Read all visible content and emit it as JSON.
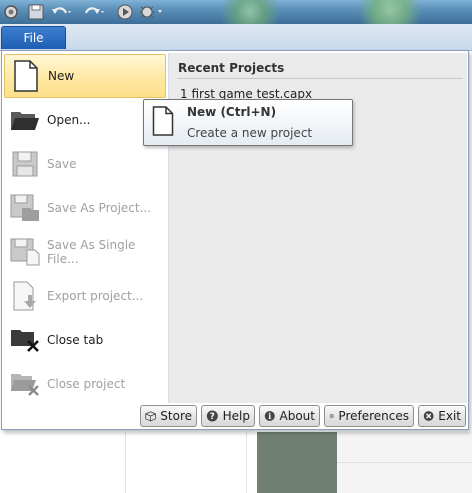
{
  "window": {
    "file_tab_label": "File"
  },
  "menu": {
    "items": [
      {
        "label": "New",
        "enabled": true,
        "icon": "new-document-icon"
      },
      {
        "label": "Open...",
        "enabled": true,
        "icon": "open-folder-icon"
      },
      {
        "label": "Save",
        "enabled": false,
        "icon": "save-icon"
      },
      {
        "label": "Save As Project...",
        "enabled": false,
        "icon": "save-as-project-icon"
      },
      {
        "label": "Save As Single File...",
        "enabled": false,
        "icon": "save-as-single-file-icon"
      },
      {
        "label": "Export project...",
        "enabled": false,
        "icon": "export-icon"
      },
      {
        "label": "Close tab",
        "enabled": true,
        "icon": "close-tab-icon"
      },
      {
        "label": "Close project",
        "enabled": false,
        "icon": "close-project-icon"
      }
    ]
  },
  "recent": {
    "title": "Recent Projects",
    "items": [
      "1 first game test.capx"
    ]
  },
  "tooltip": {
    "title": "New (Ctrl+N)",
    "description": "Create a new project"
  },
  "bottom_buttons": {
    "store": "Store",
    "help": "Help",
    "about": "About",
    "preferences": "Preferences",
    "exit": "Exit"
  },
  "colors": {
    "highlight": "#ffe8a3",
    "file_tab": "#2a6cc2",
    "panel": "#eaeaea"
  }
}
